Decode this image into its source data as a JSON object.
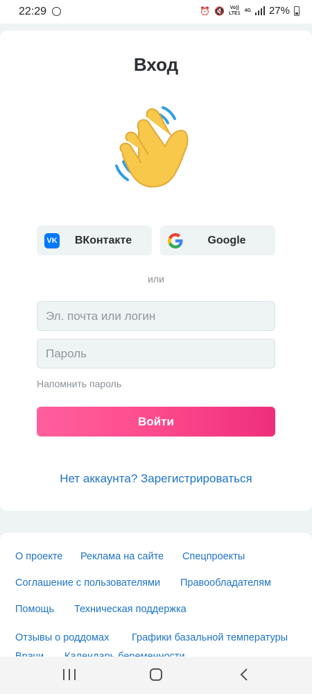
{
  "status_bar": {
    "time": "22:29",
    "network_top": "Vo))",
    "network_bottom": "LTE1",
    "signal_type": "4G",
    "battery": "27%",
    "icons": [
      "alarm-icon",
      "mute-icon",
      "signal-icon",
      "battery-icon"
    ]
  },
  "login": {
    "title": "Вход",
    "hero_icon": "waving-hand-icon",
    "vk_label": "ВКонтакте",
    "google_label": "Google",
    "or_text": "или",
    "email_placeholder": "Эл. почта или логин",
    "password_placeholder": "Пароль",
    "forgot_label": "Напомнить пароль",
    "submit_label": "Войти",
    "register_label": "Нет аккаунта? Зарегистрироваться"
  },
  "footer": {
    "links": [
      "О проекте",
      "Реклама на сайте",
      "Спецпроекты",
      "Соглашение с пользователями",
      "Правообладателям",
      "Помощь",
      "Техническая поддержка",
      "Отзывы о роддомах",
      "Графики базальной температуры",
      "Врачи",
      "Календарь беременности"
    ]
  },
  "colors": {
    "accent_pink": "#ff4f90",
    "link_blue": "#1e74c8",
    "vk_blue": "#0077ff",
    "background": "#eef3f4"
  }
}
